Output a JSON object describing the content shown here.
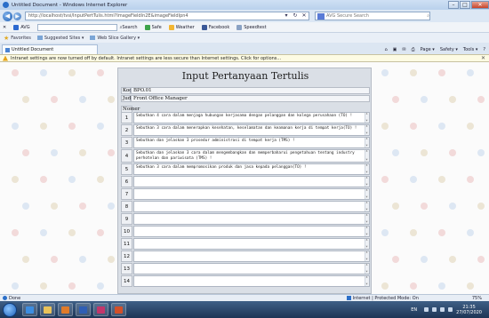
{
  "window": {
    "title": "Untitled Document - Windows Internet Explorer"
  },
  "address": {
    "url": "http://localhost/tvsi/InputPertTulis.html?ImageFieldIn2E&imageFieldIpn4"
  },
  "search": {
    "placeholder": "AVG Secure Search"
  },
  "avg_toolbar": {
    "brand": "AVG",
    "search_label": "Search",
    "safe_label": "Safe",
    "weather_label": "Weather",
    "facebook_label": "Facebook",
    "speedtest_label": "Speedtest"
  },
  "favorites_bar": {
    "favorites_label": "Favorites",
    "suggested_label": "Suggested Sites ▾",
    "webslice_label": "Web Slice Gallery ▾"
  },
  "tab": {
    "label": "Untitled Document"
  },
  "command_bar": {
    "page_label": "Page ▾",
    "safety_label": "Safety ▾",
    "tools_label": "Tools ▾"
  },
  "infobar": {
    "text": "Intranet settings are now turned off by default. Intranet settings are less secure than Internet settings. Click for options..."
  },
  "form": {
    "title": "Input Pertanyaan Tertulis",
    "kode_label": "Kode",
    "kode_value": "BPO.01",
    "judul_label": "Judul",
    "judul_value": "Front Office Manager",
    "nama_label": "Nomer",
    "rows": [
      {
        "num": "1",
        "text": "Sebutkan 4 cara dalam menjaga hubungan kerjasama dengan pelanggan dan kolega perusahaan (TO) !"
      },
      {
        "num": "2",
        "text": "Sebutkan 3 cara dalam menerapkan kesehatan, keselamatan dan keamanan kerja di tempat kerja(TO) !"
      },
      {
        "num": "3",
        "text": "Sebutkan dan jelaskan 3 prosedur administrasi di tempat kerja (TMS) !"
      },
      {
        "num": "4",
        "text": "Sebutkan dan jelaskan 3 cara dalam mengembangkan dan memperbaharui pengetahuan tentang industry perhotelan dan pariwisata (TMS) !"
      },
      {
        "num": "5",
        "text": "Sebutkan 3 cara dalam mempromosikan produk dan jasa kepada pelanggan(TO) !"
      },
      {
        "num": "6",
        "text": ""
      },
      {
        "num": "7",
        "text": ""
      },
      {
        "num": "8",
        "text": ""
      },
      {
        "num": "9",
        "text": ""
      },
      {
        "num": "10",
        "text": ""
      },
      {
        "num": "11",
        "text": ""
      },
      {
        "num": "12",
        "text": ""
      },
      {
        "num": "13",
        "text": ""
      },
      {
        "num": "14",
        "text": ""
      }
    ]
  },
  "status": {
    "done": "Done",
    "zone": "Internet | Protected Mode: On",
    "zoom": "75%"
  },
  "taskbar": {
    "lang": "EN",
    "time": "21:35",
    "date": "27/07/2020"
  },
  "colors": {
    "taskbar": "#1d3555",
    "infobar": "#fdfbe3"
  }
}
